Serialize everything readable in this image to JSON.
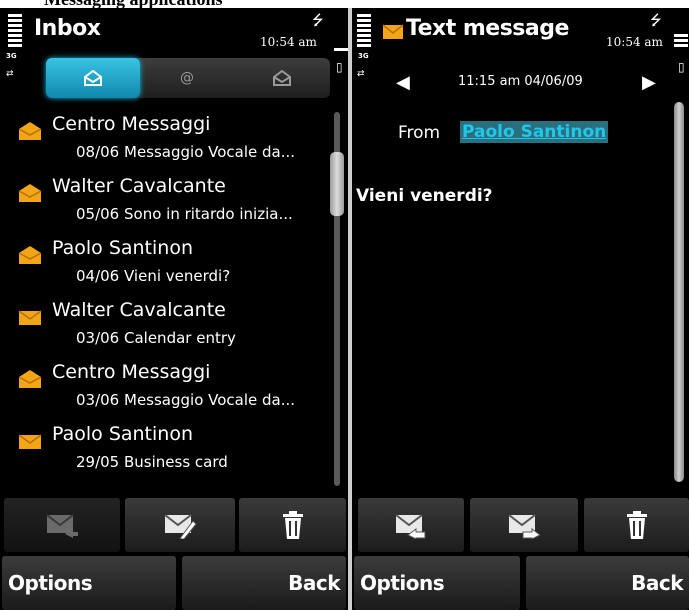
{
  "page_caption": "Messaging applications",
  "left_screen": {
    "title": "Inbox",
    "clock": "10:54 am",
    "network_label": "3G",
    "tabs": [
      {
        "name": "inbox-tab",
        "icon": "envelope-in-icon",
        "active": true
      },
      {
        "name": "email-tab",
        "icon": "at-sign-icon",
        "active": false
      },
      {
        "name": "outbox-tab",
        "icon": "envelope-out-icon",
        "active": false
      }
    ],
    "messages": [
      {
        "sender": "Centro Messaggi",
        "preview": "08/06  Messaggio Vocale da...",
        "icon": "open-envelope-icon"
      },
      {
        "sender": "Walter Cavalcante",
        "preview": "05/06  Sono in ritardo inizia...",
        "icon": "open-envelope-icon"
      },
      {
        "sender": "Paolo Santinon",
        "preview": "04/06  Vieni venerdi?",
        "icon": "open-envelope-icon"
      },
      {
        "sender": "Walter Cavalcante",
        "preview": "03/06  Calendar entry",
        "icon": "closed-envelope-icon"
      },
      {
        "sender": "Centro Messaggi",
        "preview": "03/06  Messaggio Vocale da...",
        "icon": "open-envelope-icon"
      },
      {
        "sender": "Paolo Santinon",
        "preview": "29/05  Business card",
        "icon": "closed-envelope-icon"
      }
    ],
    "toolbar": [
      "reply-icon",
      "new-message-icon",
      "trash-icon"
    ],
    "softkeys": {
      "left": "Options",
      "right": "Back"
    }
  },
  "right_screen": {
    "title": "Text message",
    "clock": "10:54 am",
    "network_label": "3G",
    "timestamp": "11:15 am 04/06/09",
    "from_label": "From",
    "from_value": "Paolo Santinon",
    "body": "Vieni venerdi?",
    "toolbar": [
      "reply-icon",
      "forward-icon",
      "trash-icon"
    ],
    "softkeys": {
      "left": "Options",
      "right": "Back"
    }
  },
  "colors": {
    "accent": "#1aa7d0",
    "envelope": "#f2a516",
    "link": "#21c7e8",
    "background": "#000000"
  }
}
